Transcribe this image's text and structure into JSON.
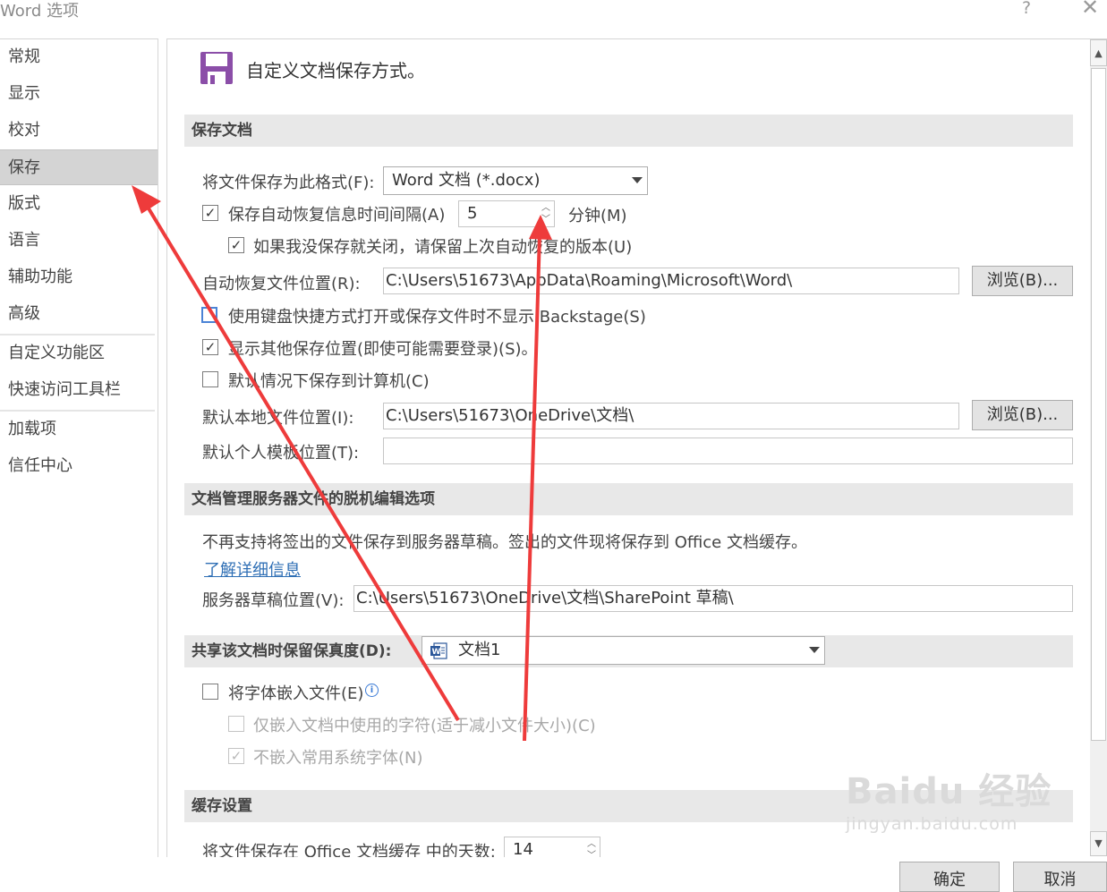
{
  "window": {
    "title": "Word 选项",
    "help_label": "?",
    "close_label": "✕"
  },
  "nav": {
    "items": [
      {
        "label": "常规"
      },
      {
        "label": "显示"
      },
      {
        "label": "校对"
      },
      {
        "label": "保存"
      },
      {
        "label": "版式"
      },
      {
        "label": "语言"
      },
      {
        "label": "辅助功能"
      },
      {
        "label": "高级"
      },
      {
        "label": "自定义功能区"
      },
      {
        "label": "快速访问工具栏"
      },
      {
        "label": "加载项"
      },
      {
        "label": "信任中心"
      }
    ],
    "selected": "保存"
  },
  "header": {
    "text": "自定义文档保存方式。",
    "icon": "floppy-disk-icon",
    "icon_color": "#8b4ea8"
  },
  "save_docs": {
    "section_title": "保存文档",
    "format_label": "将文件保存为此格式(F):",
    "format_value": "Word 文档 (*.docx)",
    "autorecover_label": "保存自动恢复信息时间间隔(A)",
    "autorecover_checked": true,
    "autorecover_minutes": "5",
    "minutes_label": "分钟(M)",
    "keep_last_label": "如果我没保存就关闭，请保留上次自动恢复的版本(U)",
    "keep_last_checked": true,
    "autorecover_location_label": "自动恢复文件位置(R):",
    "autorecover_location_value": "C:\\Users\\51673\\AppData\\Roaming\\Microsoft\\Word\\",
    "browse1_label": "浏览(B)...",
    "no_backstage_label": "使用键盘快捷方式打开或保存文件时不显示 Backstage(S)",
    "no_backstage_checked": false,
    "show_other_label": "显示其他保存位置(即使可能需要登录)(S)。",
    "show_other_checked": true,
    "save_to_computer_label": "默认情况下保存到计算机(C)",
    "save_to_computer_checked": false,
    "local_location_label": "默认本地文件位置(I):",
    "local_location_value": "C:\\Users\\51673\\OneDrive\\文档\\",
    "browse2_label": "浏览(B)...",
    "template_location_label": "默认个人模板位置(T):",
    "template_location_value": ""
  },
  "offline": {
    "section_title": "文档管理服务器文件的脱机编辑选项",
    "notice": "不再支持将签出的文件保存到服务器草稿。签出的文件现将保存到 Office 文档缓存。",
    "learn_more": "了解详细信息",
    "drafts_label": "服务器草稿位置(V):",
    "drafts_value": "C:\\Users\\51673\\OneDrive\\文档\\SharePoint 草稿\\"
  },
  "fidelity": {
    "section_title": "共享该文档时保留保真度(D):",
    "doc_value": "文档1",
    "doc_icon": "word-document-icon",
    "embed_fonts_label": "将字体嵌入文件(E)",
    "embed_fonts_checked": false,
    "only_used_chars_label": "仅嵌入文档中使用的字符(适于减小文件大小)(C)",
    "only_used_chars_checked": false,
    "no_common_fonts_label": "不嵌入常用系统字体(N)",
    "no_common_fonts_checked": true
  },
  "cache": {
    "section_title": "缓存设置",
    "days_label": "将文件保存在 Office 文档缓存 中的天数:",
    "days_value": "14"
  },
  "footer": {
    "ok_label": "确定",
    "cancel_label": "取消"
  },
  "watermark": {
    "brand": "Baidu 经验",
    "url": "jingyan.baidu.com"
  },
  "annotation_color": "#ee3b3b"
}
